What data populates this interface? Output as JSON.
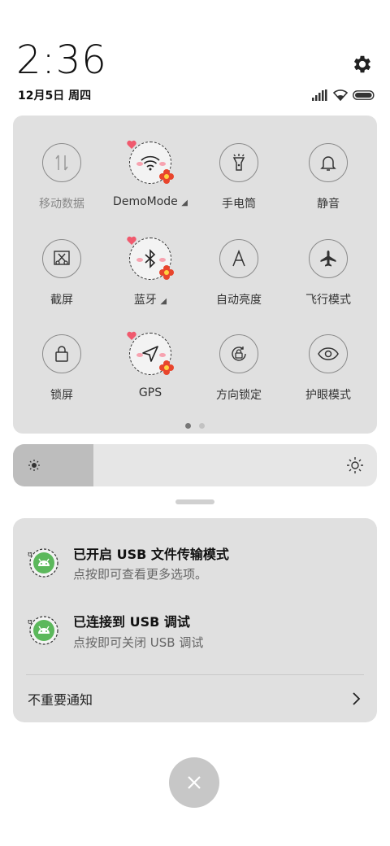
{
  "status": {
    "time": "2:36",
    "date": "12月5日 周四"
  },
  "tiles": [
    {
      "label": "移动数据",
      "icon": "mobile-data-icon",
      "dim": true
    },
    {
      "label": "DemoMode",
      "icon": "wifi-icon",
      "expand": true
    },
    {
      "label": "手电筒",
      "icon": "flashlight-icon"
    },
    {
      "label": "静音",
      "icon": "bell-icon"
    },
    {
      "label": "截屏",
      "icon": "screenshot-icon"
    },
    {
      "label": "蓝牙",
      "icon": "bluetooth-icon",
      "expand": true
    },
    {
      "label": "自动亮度",
      "icon": "auto-brightness-icon"
    },
    {
      "label": "飞行模式",
      "icon": "airplane-icon"
    },
    {
      "label": "锁屏",
      "icon": "lock-icon"
    },
    {
      "label": "GPS",
      "icon": "location-icon"
    },
    {
      "label": "方向锁定",
      "icon": "rotation-lock-icon"
    },
    {
      "label": "护眼模式",
      "icon": "eye-icon"
    }
  ],
  "brightness": {
    "level": 0.22
  },
  "pager": {
    "pages": 2,
    "current": 1
  },
  "notifications": [
    {
      "title": "已开启 USB 文件传输模式",
      "subtitle": "点按即可查看更多选项。",
      "icon": "android-icon"
    },
    {
      "title": "已连接到 USB 调试",
      "subtitle": "点按即可关闭 USB 调试",
      "icon": "android-icon"
    }
  ],
  "unimportant": {
    "label": "不重要通知"
  },
  "colors": {
    "panel": "#e0e0e0",
    "android_green": "#5cb85c",
    "blush": "#f7a3b0",
    "flower": "#e8452c"
  }
}
